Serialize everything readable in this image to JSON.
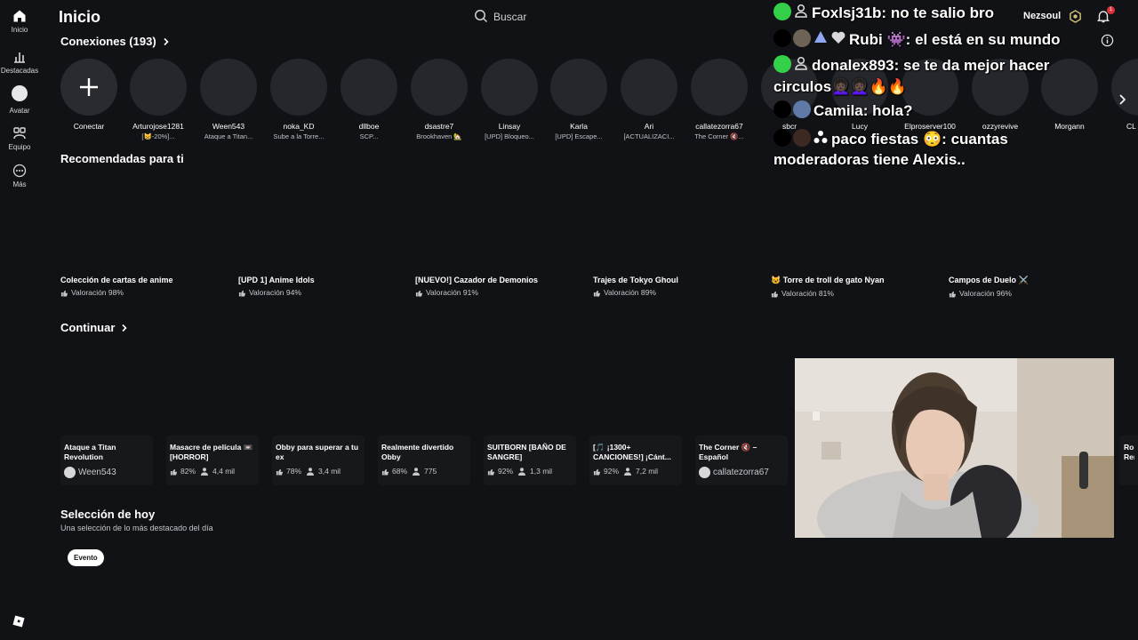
{
  "rail": {
    "items": [
      {
        "label": "Inicio",
        "icon": "home-icon"
      },
      {
        "label": "Destacadas",
        "icon": "chart-icon"
      },
      {
        "label": "Avatar",
        "icon": "avatar-icon"
      },
      {
        "label": "Equipo",
        "icon": "group-icon"
      },
      {
        "label": "Más",
        "icon": "more-icon"
      }
    ]
  },
  "header": {
    "title": "Inicio",
    "search_label": "Buscar",
    "username": "Nezsoul",
    "notification_count": "1"
  },
  "connections": {
    "title": "Conexiones (193)",
    "add_label": "Conectar",
    "friends": [
      {
        "name": "Arturojose1281",
        "status": "[😸-20%]..."
      },
      {
        "name": "Ween543",
        "status": "Ataque a Titan..."
      },
      {
        "name": "noka_KD",
        "status": "Sube a la Torre..."
      },
      {
        "name": "dllboe",
        "status": "SCP..."
      },
      {
        "name": "dsastre7",
        "status": "Brookhaven 🏡"
      },
      {
        "name": "Linsay",
        "status": "[UPD] Bloqueo..."
      },
      {
        "name": "Karla",
        "status": "[UPD] Escape..."
      },
      {
        "name": "Ari",
        "status": "[ACTUALIZACI..."
      },
      {
        "name": "callatezorra67",
        "status": "The Corner 🔇..."
      },
      {
        "name": "sbcr",
        "status": ""
      },
      {
        "name": "Lucy",
        "status": ""
      },
      {
        "name": "Elproserver100",
        "status": ""
      },
      {
        "name": "ozzyrevive",
        "status": ""
      },
      {
        "name": "Morgann",
        "status": ""
      },
      {
        "name": "CL",
        "status": ""
      }
    ]
  },
  "recommended": {
    "title": "Recomendadas para ti",
    "items": [
      {
        "title": "Colección de cartas de anime",
        "rating": "Valoración 98%"
      },
      {
        "title": "[UPD 1] Anime Idols",
        "rating": "Valoración 94%"
      },
      {
        "title": "[NUEVO!] Cazador de Demonios",
        "rating": "Valoración 91%"
      },
      {
        "title": "Trajes de Tokyo Ghoul",
        "rating": "Valoración 89%"
      },
      {
        "title": "😺 Torre de troll de gato Nyan",
        "rating": "Valoración 81%"
      },
      {
        "title": "Campos de Duelo ⚔️",
        "rating": "Valoración 96%"
      }
    ]
  },
  "continue": {
    "title": "Continuar",
    "items": [
      {
        "title": "Ataque a Titan Revolution",
        "creator": "Ween543"
      },
      {
        "title": "Masacre de película 📼 [HORROR]",
        "rating": "82%",
        "players": "4,4 mil"
      },
      {
        "title": "Obby para superar a tu ex",
        "rating": "78%",
        "players": "3,4 mil"
      },
      {
        "title": "Realmente divertido Obby",
        "rating": "68%",
        "players": "775"
      },
      {
        "title": "SUITBORN [BAÑO DE SANGRE]",
        "rating": "92%",
        "players": "1,3 mil"
      },
      {
        "title": "[🎵 ¡1300+ CANCIONES!] ¡Cánt...",
        "rating": "92%",
        "players": "7,2 mil"
      },
      {
        "title": "The Corner 🔇 – Español",
        "creator": "callatezorra67"
      },
      {
        "title": "Rop Rem",
        "creator": ""
      }
    ]
  },
  "daily": {
    "title": "Selección de hoy",
    "subtitle": "Una selección de lo más destacado del día",
    "chip": "Evento"
  },
  "chat": {
    "messages": [
      {
        "user": "Foxlsj31b:",
        "text": "no te salio bro"
      },
      {
        "user": "Rubi 👾:",
        "text": "el está en su mundo"
      },
      {
        "user": "donalex893:",
        "text": "se te da mejor hacer"
      },
      {
        "user": "",
        "text": "circulos👩🏿‍🦱👩🏿‍🦱🔥🔥"
      },
      {
        "user": "Camila:",
        "text": "hola?"
      },
      {
        "user": "paco fiestas 😳:",
        "text": "cuantas"
      },
      {
        "user": "",
        "text": "moderadoras tiene Alexis.."
      }
    ]
  },
  "colors": {
    "background": "#111216",
    "card": "#17181c",
    "avatar_placeholder": "#26272c",
    "badge_green": "#35d04a",
    "notification_red": "#e0303a"
  }
}
